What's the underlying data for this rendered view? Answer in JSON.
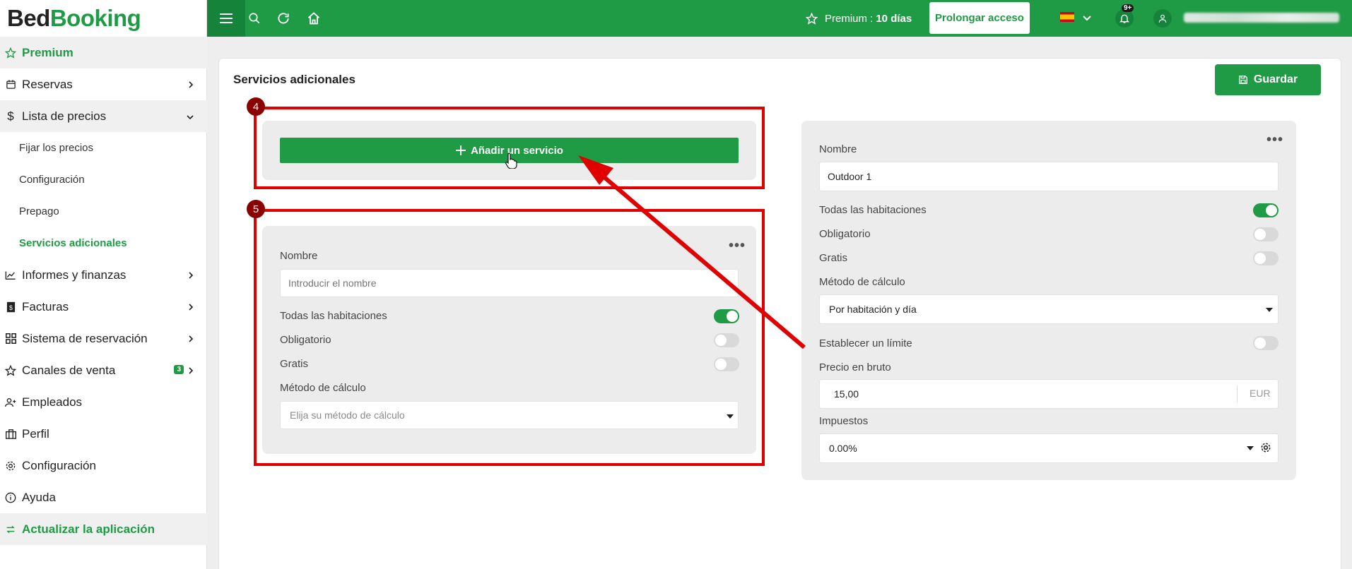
{
  "logo": {
    "part1": "Bed",
    "part2": "Booking"
  },
  "sidebar": {
    "premium": "Premium",
    "items": [
      {
        "label": "Reservas"
      },
      {
        "label": "Lista de precios"
      },
      {
        "label": "Informes y finanzas"
      },
      {
        "label": "Facturas"
      },
      {
        "label": "Sistema de reservación"
      },
      {
        "label": "Canales de venta",
        "badge": "3"
      },
      {
        "label": "Empleados"
      },
      {
        "label": "Perfil"
      },
      {
        "label": "Configuración"
      },
      {
        "label": "Ayuda"
      }
    ],
    "subitems": [
      "Fijar los precios",
      "Configuración",
      "Prepago",
      "Servicios adicionales"
    ],
    "update": "Actualizar la aplicación"
  },
  "topbar": {
    "premium_label": "Premium :",
    "premium_days": "10 días",
    "extend_button": "Prolongar acceso",
    "notif_badge": "9+"
  },
  "page": {
    "title": "Servicios adicionales",
    "save_button": "Guardar",
    "add_button": "Añadir un servicio"
  },
  "new_service": {
    "name_label": "Nombre",
    "name_placeholder": "Introducir el nombre",
    "all_rooms": "Todas las habitaciones",
    "mandatory": "Obligatorio",
    "free": "Gratis",
    "calc_label": "Método de cálculo",
    "calc_placeholder": "Elija su método de cálculo"
  },
  "existing_service": {
    "name_label": "Nombre",
    "name_value": "Outdoor 1",
    "all_rooms": "Todas las habitaciones",
    "mandatory": "Obligatorio",
    "free": "Gratis",
    "calc_label": "Método de cálculo",
    "calc_value": "Por habitación y día",
    "limit": "Establecer un límite",
    "gross_price_label": "Precio en bruto",
    "gross_price_value": "15,00",
    "currency": "EUR",
    "taxes_label": "Impuestos",
    "taxes_value": "0.00%"
  },
  "annotations": {
    "step4": "4",
    "step5": "5"
  },
  "colors": {
    "brand": "#1f9a45",
    "annotation": "#e00000"
  }
}
